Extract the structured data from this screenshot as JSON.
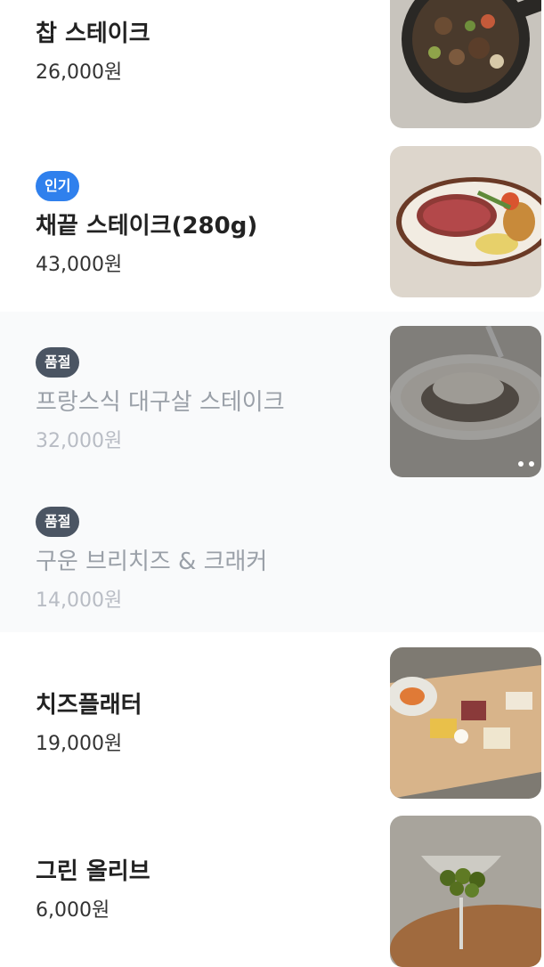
{
  "menu": {
    "items": [
      {
        "name": "찹 스테이크",
        "price": "26,000원",
        "badge": "",
        "thumb_icon": "chop-steak-photo"
      },
      {
        "name": "채끝 스테이크(280g)",
        "price": "43,000원",
        "badge": "인기",
        "thumb_icon": "sirloin-steak-photo"
      },
      {
        "name": "프랑스식 대구살 스테이크",
        "price": "32,000원",
        "badge": "품절",
        "thumb_icon": "cod-steak-photo"
      },
      {
        "name": "구운 브리치즈 & 크래커",
        "price": "14,000원",
        "badge": "품절"
      },
      {
        "name": "치즈플래터",
        "price": "19,000원",
        "badge": "",
        "thumb_icon": "cheese-platter-photo"
      },
      {
        "name": "그린 올리브",
        "price": "6,000원",
        "badge": "",
        "thumb_icon": "green-olive-photo"
      }
    ]
  },
  "colors": {
    "popular_badge": "#2f80ed",
    "soldout_badge": "#4b5563",
    "soldout_bg": "#f9fafb"
  }
}
